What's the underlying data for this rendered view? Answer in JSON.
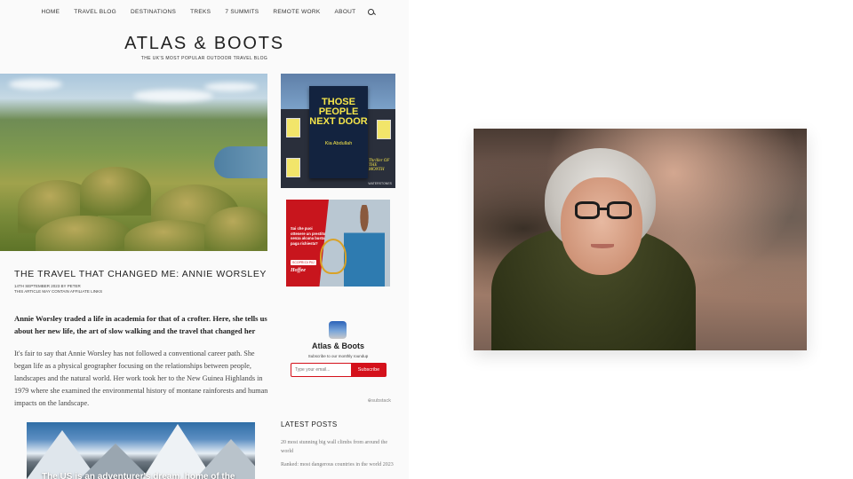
{
  "nav": {
    "items": [
      "HOME",
      "TRAVEL BLOG",
      "DESTINATIONS",
      "TREKS",
      "7 SUMMITS",
      "REMOTE WORK",
      "ABOUT"
    ],
    "search_icon": "search-icon"
  },
  "site": {
    "title": "ATLAS & BOOTS",
    "tagline": "THE UK'S MOST POPULAR OUTDOOR TRAVEL BLOG"
  },
  "article": {
    "title": "THE TRAVEL THAT CHANGED ME: ANNIE WORSLEY",
    "meta_line1": "14TH SEPTEMBER 2023 BY PETER",
    "meta_line2": "THIS ARTICLE MAY CONTAIN AFFILIATE LINKS",
    "intro": "Annie Worsley traded a life in academia for that of a crofter. Here, she tells us about her new life, the art of slow walking and the travel that changed her",
    "body": "It's fair to say that Annie Worsley has not followed a conventional career path. She began life as a physical geographer focusing on the relationships between people, landscapes and the natural world. Her work took her to the New Guinea Highlands in 1979 where she examined the environmental history of montane rainforests and human impacts on the landscape.",
    "inline_caption": "The US is an adventurer's dream, home of the"
  },
  "ads": {
    "book": {
      "title": "THOSE PEOPLE NEXT DOOR",
      "author": "Kia Abdullah",
      "badge": "Thriller OF THE MONTH",
      "publisher": "WATERSTONES"
    },
    "hoffee": {
      "text": "Sai che puoi ottenere un prestito senza alcuna busta paga richiesta?",
      "button": "SCOPRI DI PIÙ",
      "brand": "Hoffee"
    }
  },
  "substack": {
    "name": "Atlas & Boots",
    "subtitle": "Subscribe to our monthly roundup",
    "email_placeholder": "Type your email...",
    "subscribe_label": "Subscribe",
    "powered": "⊕substack"
  },
  "latest": {
    "title": "LATEST POSTS",
    "items": [
      "20 most stunning big wall climbs from around the world",
      "Ranked: most dangerous countries in the world 2023"
    ]
  },
  "colors": {
    "accent_red": "#d4111b",
    "book_yellow": "#f5e54a"
  }
}
